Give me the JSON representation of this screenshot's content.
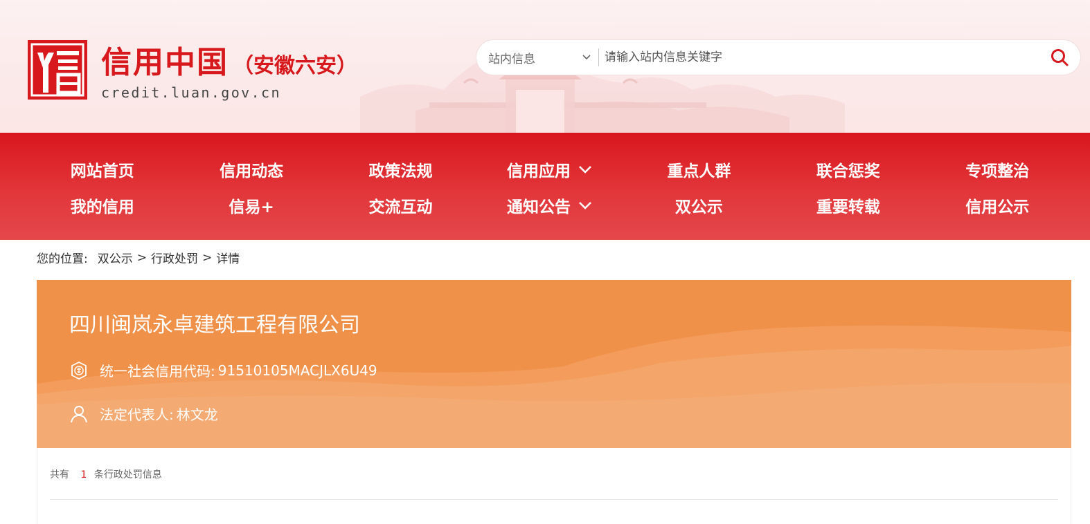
{
  "header": {
    "logo_title": "信用中国",
    "logo_subtitle": "（安徽六安）",
    "logo_url": "credit.luan.gov.cn",
    "search": {
      "scope_value": "站内信息",
      "placeholder": "请输入站内信息关键字"
    }
  },
  "nav": {
    "row1": [
      {
        "label": "网站首页"
      },
      {
        "label": "信用动态"
      },
      {
        "label": "政策法规"
      },
      {
        "label": "信用应用",
        "dropdown": true
      },
      {
        "label": "重点人群"
      },
      {
        "label": "联合惩奖"
      },
      {
        "label": "专项整治"
      }
    ],
    "row2": [
      {
        "label": "我的信用"
      },
      {
        "label": "信易+"
      },
      {
        "label": "交流互动"
      },
      {
        "label": "通知公告",
        "dropdown": true
      },
      {
        "label": "双公示"
      },
      {
        "label": "重要转载"
      },
      {
        "label": "信用公示"
      }
    ]
  },
  "breadcrumb": {
    "prefix": "您的位置:",
    "items": [
      "双公示",
      "行政处罚",
      "详情"
    ],
    "separator": ">"
  },
  "detail": {
    "company_name": "四川闽岚永卓建筑工程有限公司",
    "credit_code_label": "统一社会信用代码:",
    "credit_code": "91510105MACJLX6U49",
    "legal_rep_label": "法定代表人:",
    "legal_rep": "林文龙"
  },
  "records": {
    "prefix": "共有",
    "count": "1",
    "suffix": "条行政处罚信息"
  },
  "colors": {
    "brand_red": "#d7191e",
    "banner_orange": "#f0914a",
    "header_bg": "#fbe9e9"
  }
}
